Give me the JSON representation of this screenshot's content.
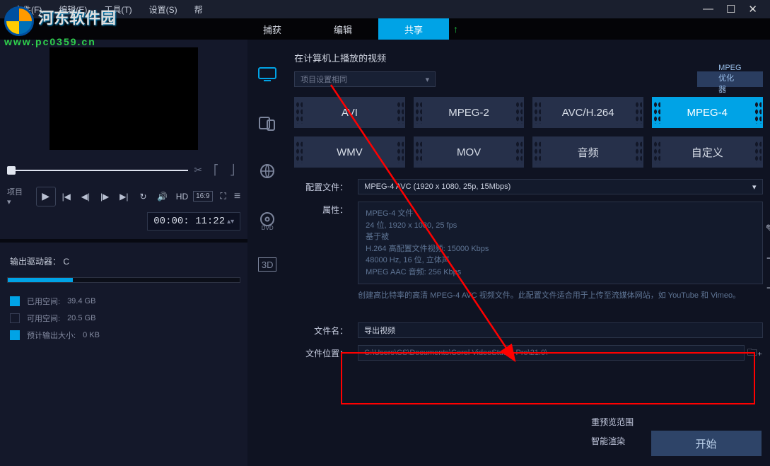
{
  "menu": {
    "file": "文件(F)",
    "edit": "编辑(E)",
    "tool": "工具(T)",
    "setting": "设置(S)",
    "more": "帮"
  },
  "tabs": {
    "capture": "捕获",
    "edit": "编辑",
    "share": "共享"
  },
  "watermark": {
    "name": "河东软件园",
    "url": "www.pc0359.cn"
  },
  "player": {
    "project": "项目",
    "hd": "HD",
    "aspect": "16:9",
    "timecode": "00:00: 11:22"
  },
  "disk": {
    "driver_label": "输出驱动器：",
    "driver_value": "C",
    "used_label": "已用空间:",
    "used_value": "39.4 GB",
    "free_label": "可用空间:",
    "free_value": "20.5 GB",
    "est_label": "预计输出大小:",
    "est_value": "0 KB"
  },
  "share": {
    "heading": "在计算机上播放的视频",
    "subset_label": "项目设置相同",
    "mpeg_opt": "MPEG 优化器",
    "formats": [
      "AVI",
      "MPEG-2",
      "AVC/H.264",
      "MPEG-4",
      "WMV",
      "MOV",
      "音频",
      "自定义"
    ],
    "active_format_index": 3,
    "profile_label": "配置文件：",
    "profile_value": "MPEG-4 AVC (1920 x 1080, 25p, 15Mbps)",
    "props_label": "属性：",
    "props_lines": [
      "MPEG-4 文件",
      "24 位, 1920 x 1080, 25 fps",
      "基于被",
      "H.264 高配置文件视频: 15000 Kbps",
      "48000 Hz, 16 位, 立体声",
      "MPEG AAC 音频: 256 Kbps"
    ],
    "desc": "创建高比特率的高清 MPEG-4 AVC 视频文件。此配置文件适合用于上传至流媒体网站，如 YouTube 和 Vimeo。",
    "filename_label": "文件名：",
    "filename_value": "导出视频",
    "filepath_label": "文件位置：",
    "filepath_value": "C:\\Users\\CS\\Documents\\Corel VideoStudio Pro\\21.0\\",
    "range_label": "重预览范围",
    "smart_label": "智能渲染",
    "start": "开始"
  }
}
